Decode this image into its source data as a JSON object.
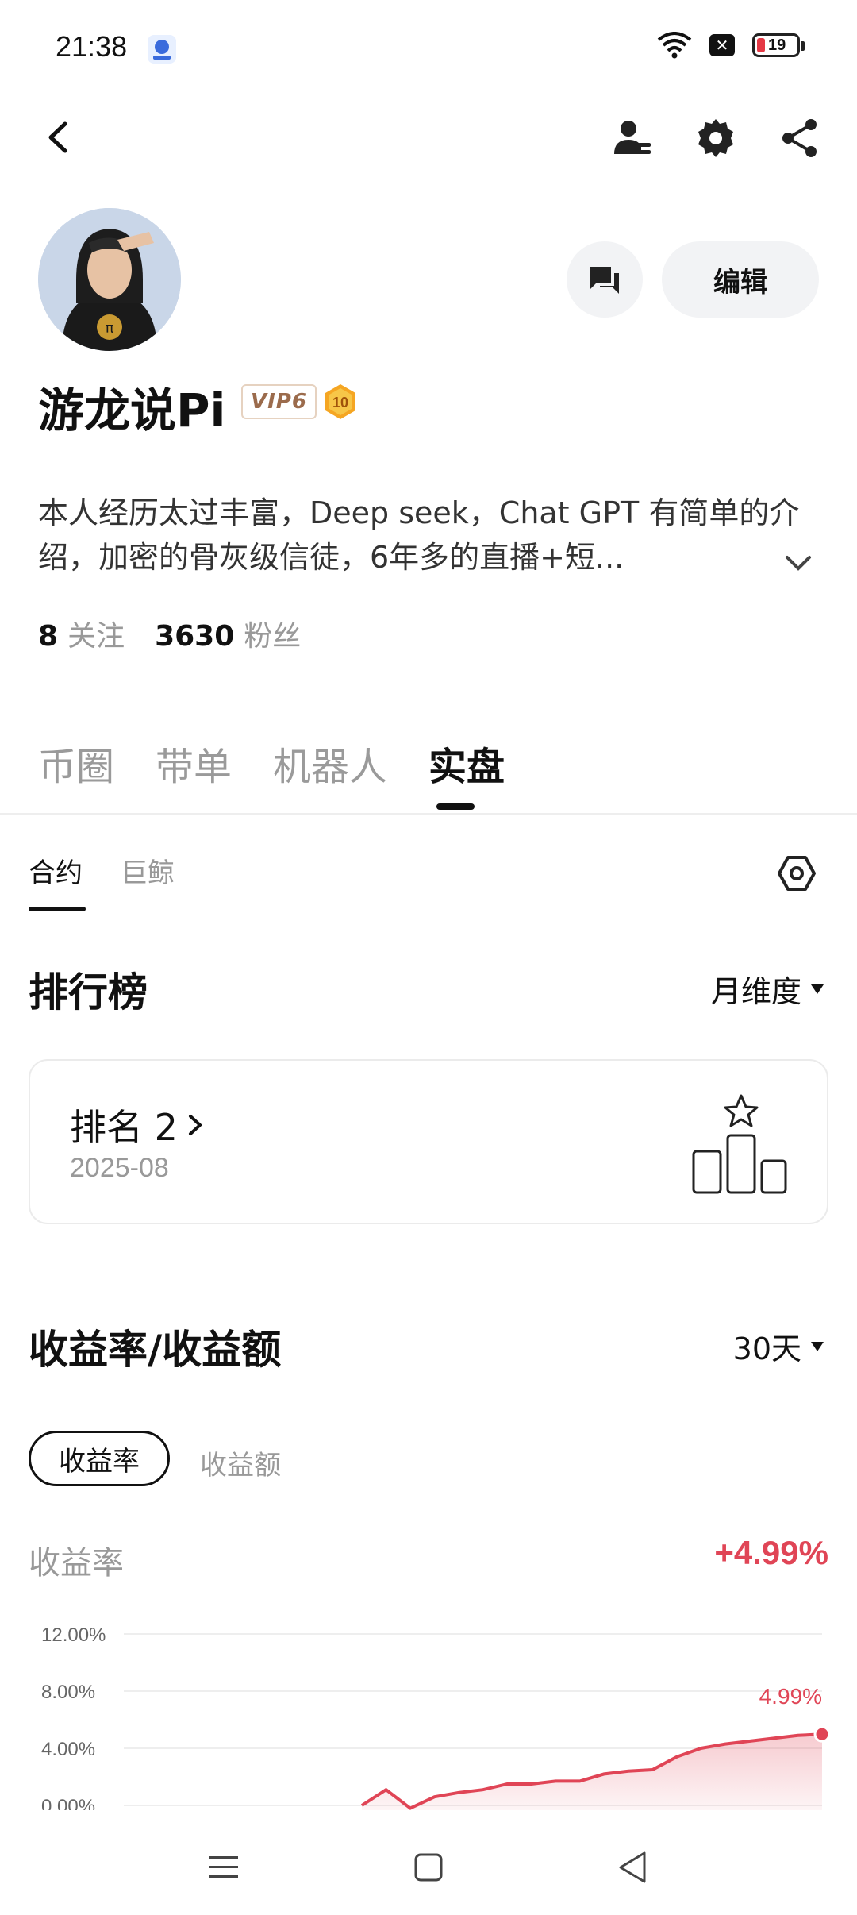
{
  "status_bar": {
    "time": "21:38",
    "battery": "19",
    "icons": [
      "wifi-icon",
      "notification-x-icon",
      "battery-icon"
    ]
  },
  "header": {
    "icons": [
      "back-icon",
      "user-manage-icon",
      "settings-icon",
      "share-icon"
    ]
  },
  "profile": {
    "name": "游龙说Pi",
    "vip_badge": "VIP6",
    "level_badge": "10",
    "edit_label": "编辑",
    "bio": "本人经历太过丰富，Deep seek，Chat GPT 有简单的介绍，加密的骨灰级信徒，6年多的直播+短...",
    "following_count": "8",
    "following_label": "关注",
    "followers_count": "3630",
    "followers_label": "粉丝"
  },
  "tabs": [
    {
      "label": "币圈",
      "active": false
    },
    {
      "label": "带单",
      "active": false
    },
    {
      "label": "机器人",
      "active": false
    },
    {
      "label": "实盘",
      "active": true
    }
  ],
  "subtabs": [
    {
      "label": "合约",
      "active": true
    },
    {
      "label": "巨鲸",
      "active": false
    }
  ],
  "ranking": {
    "title": "排行榜",
    "period": "月维度",
    "rank_label": "排名 2",
    "date": "2025-08"
  },
  "returns": {
    "title": "收益率/收益额",
    "period": "30天",
    "pill_active": "收益率",
    "pill_inactive": "收益额",
    "metric_label": "收益率",
    "metric_value": "+4.99%"
  },
  "colors": {
    "accent_red": "#e04556",
    "text_primary": "#111111",
    "text_secondary": "#999999"
  },
  "chart_data": {
    "type": "area",
    "y_tick_labels": [
      "12.00%",
      "8.00%",
      "4.00%",
      "0.00%"
    ],
    "ylim": [
      0,
      12
    ],
    "end_label": "4.99%",
    "x": [
      1,
      2,
      3,
      4,
      5,
      6,
      7,
      8,
      9,
      10,
      11,
      12,
      13,
      14,
      15,
      16,
      17,
      18,
      19,
      20
    ],
    "values": [
      0.0,
      1.1,
      -0.2,
      0.6,
      0.9,
      1.1,
      1.5,
      1.5,
      1.7,
      1.7,
      2.2,
      2.4,
      2.5,
      3.4,
      4.0,
      4.3,
      4.5,
      4.7,
      4.9,
      4.99
    ]
  }
}
